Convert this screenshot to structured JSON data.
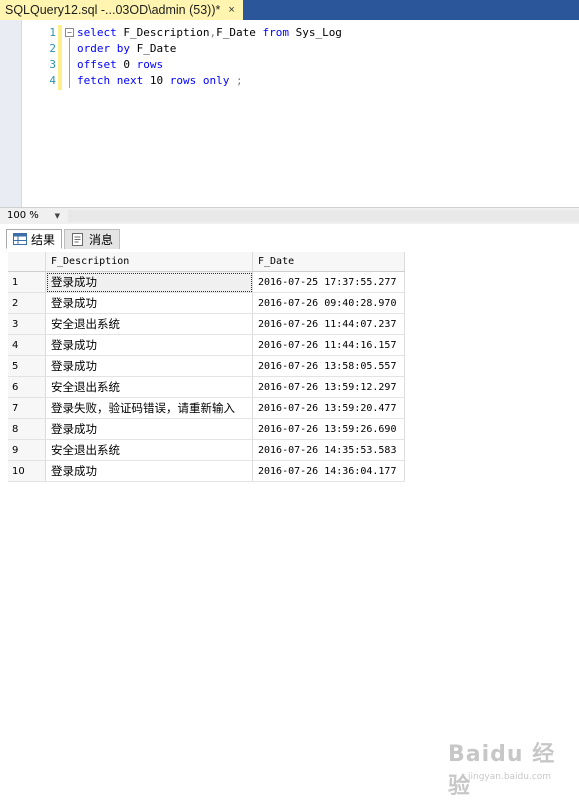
{
  "tab": {
    "title": "SQLQuery12.sql -...03OD\\admin (53))*",
    "close_glyph": "×"
  },
  "editor": {
    "line_numbers": [
      "1",
      "2",
      "3",
      "4"
    ],
    "outline_glyph": "−",
    "lines": [
      [
        {
          "t": "select",
          "c": "kw"
        },
        {
          "t": " F_Description",
          "c": ""
        },
        {
          "t": ",",
          "c": "gr"
        },
        {
          "t": "F_Date ",
          "c": ""
        },
        {
          "t": "from",
          "c": "kw"
        },
        {
          "t": " Sys_Log",
          "c": ""
        }
      ],
      [
        {
          "t": "order by",
          "c": "kw"
        },
        {
          "t": " F_Date",
          "c": ""
        }
      ],
      [
        {
          "t": "offset",
          "c": "kw"
        },
        {
          "t": " 0 ",
          "c": ""
        },
        {
          "t": "rows",
          "c": "kw"
        }
      ],
      [
        {
          "t": "fetch next",
          "c": "kw"
        },
        {
          "t": " 10 ",
          "c": ""
        },
        {
          "t": "rows only",
          "c": "kw"
        },
        {
          "t": " ;",
          "c": "gr"
        }
      ]
    ]
  },
  "zoom": {
    "value": "100 %"
  },
  "result_tabs": [
    {
      "label": "结果",
      "icon": "grid-icon"
    },
    {
      "label": "消息",
      "icon": "messages-icon"
    }
  ],
  "results": {
    "columns": [
      "F_Description",
      "F_Date"
    ],
    "rows": [
      {
        "n": "1",
        "desc": "登录成功",
        "date": "2016-07-25 17:37:55.277"
      },
      {
        "n": "2",
        "desc": "登录成功",
        "date": "2016-07-26 09:40:28.970"
      },
      {
        "n": "3",
        "desc": "安全退出系统",
        "date": "2016-07-26 11:44:07.237"
      },
      {
        "n": "4",
        "desc": "登录成功",
        "date": "2016-07-26 11:44:16.157"
      },
      {
        "n": "5",
        "desc": "登录成功",
        "date": "2016-07-26 13:58:05.557"
      },
      {
        "n": "6",
        "desc": "安全退出系统",
        "date": "2016-07-26 13:59:12.297"
      },
      {
        "n": "7",
        "desc": "登录失败，验证码错误，请重新输入",
        "date": "2016-07-26 13:59:20.477"
      },
      {
        "n": "8",
        "desc": "登录成功",
        "date": "2016-07-26 13:59:26.690"
      },
      {
        "n": "9",
        "desc": "安全退出系统",
        "date": "2016-07-26 14:35:53.583"
      },
      {
        "n": "10",
        "desc": "登录成功",
        "date": "2016-07-26 14:36:04.177"
      }
    ]
  },
  "watermark": {
    "brand": "Baidu 经验",
    "url": "jingyan.baidu.com"
  },
  "colors": {
    "tabstrip": "#2b579a",
    "active_tab": "#fff5b0",
    "keyword": "#0000ff",
    "line_number": "#2b91af"
  }
}
